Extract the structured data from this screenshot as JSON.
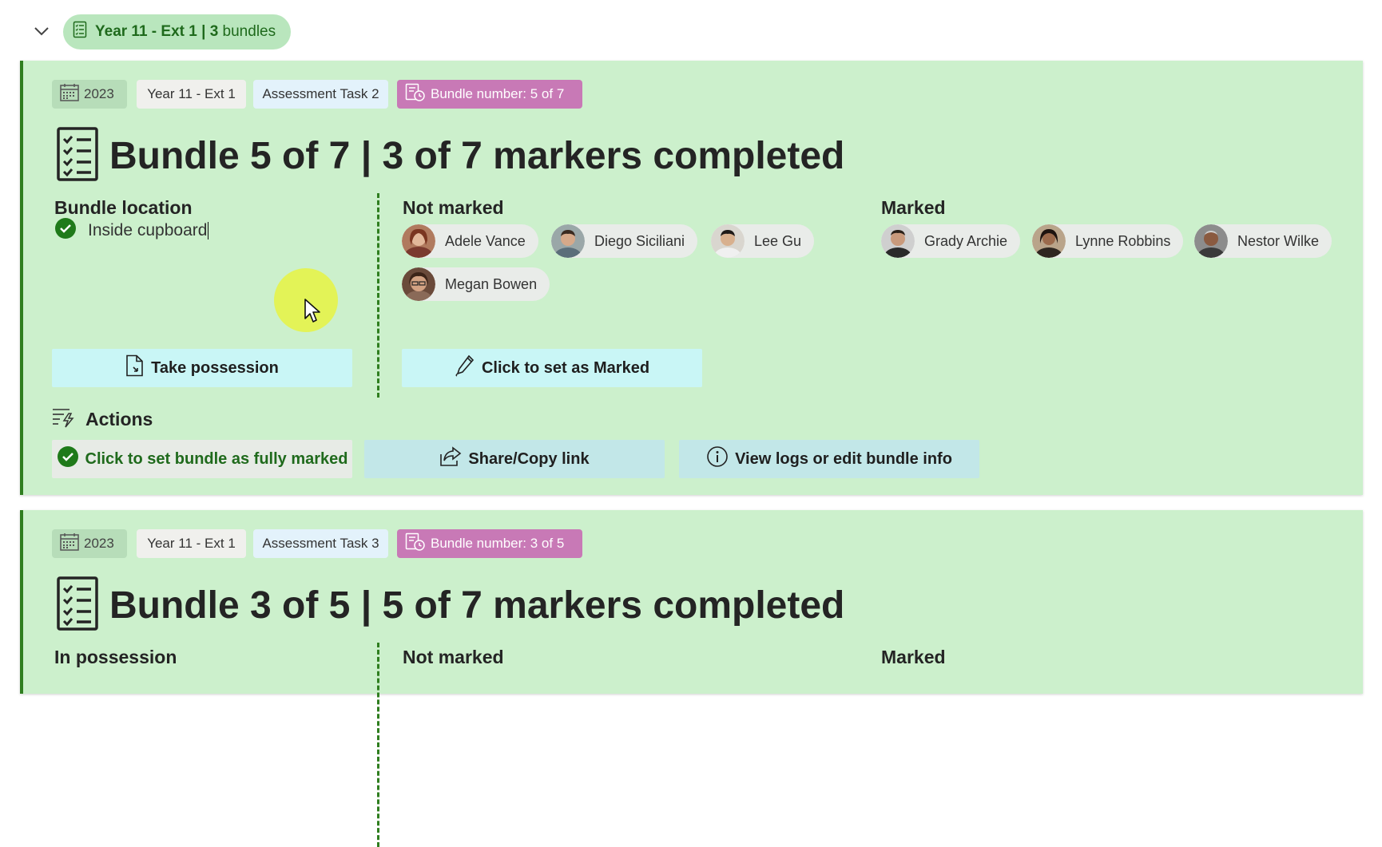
{
  "group": {
    "title_bold": "Year 11 - Ext 1 | 3",
    "title_rest": "bundles",
    "icon": "list-document-icon"
  },
  "cards": [
    {
      "tags": {
        "year": "2023",
        "class": "Year 11 - Ext 1",
        "task": "Assessment Task 2",
        "bundle": "Bundle number: 5 of 7"
      },
      "title": "Bundle 5 of 7 | 3 of 7 markers completed",
      "left_section": {
        "label": "Bundle location",
        "value": "Inside cupboard"
      },
      "not_marked": {
        "label": "Not marked",
        "people": [
          "Adele Vance",
          "Diego Siciliani",
          "Lee Gu",
          "Megan Bowen"
        ]
      },
      "marked": {
        "label": "Marked",
        "people": [
          "Grady Archie",
          "Lynne Robbins",
          "Nestor Wilke"
        ]
      },
      "buttons": {
        "take_possession": "Take possession",
        "set_marked": "Click to set as Marked"
      },
      "actions": {
        "label": "Actions",
        "fully_marked": "Click to set bundle as fully marked",
        "share": "Share/Copy link",
        "view_logs": "View logs or edit bundle info"
      }
    },
    {
      "tags": {
        "year": "2023",
        "class": "Year 11 - Ext 1",
        "task": "Assessment Task 3",
        "bundle": "Bundle number: 3 of 5"
      },
      "title": "Bundle 3 of 5 | 5 of 7 markers completed",
      "left_section": {
        "label": "In possession"
      },
      "not_marked": {
        "label": "Not marked"
      },
      "marked": {
        "label": "Marked"
      }
    }
  ],
  "colors": {
    "card_bg": "#ccf0cc",
    "accent_green": "#2f7e1f",
    "bundle_tag": "#c879b6",
    "button_cyan": "#c9f6f6",
    "button_teal": "#c2e7e8"
  }
}
